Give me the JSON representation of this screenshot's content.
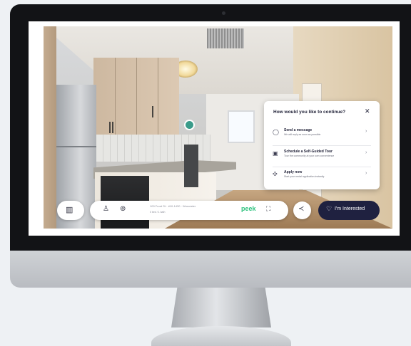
{
  "popup": {
    "title": "How would you like to continue?",
    "close_icon": "close-icon",
    "options": [
      {
        "title": "Send a message",
        "subtitle": "We will reply as soon as possible",
        "icon": "message-icon"
      },
      {
        "title": "Schedule a Self-Guided Tour",
        "subtitle": "Tour the community at your own convenience",
        "icon": "calendar-icon"
      },
      {
        "title": "Apply now",
        "subtitle": "Start your rental application instantly",
        "icon": "apply-icon"
      }
    ]
  },
  "toolbar": {
    "address": "100 Front St · #10-1430 · Worcester",
    "beds": "0 bed / 1 bath",
    "brand": "peek",
    "interested_label": "I'm Interested"
  },
  "colors": {
    "accent": "#1f2140",
    "brand": "#2ec27e",
    "nav_dot": "#3a9b8a"
  }
}
